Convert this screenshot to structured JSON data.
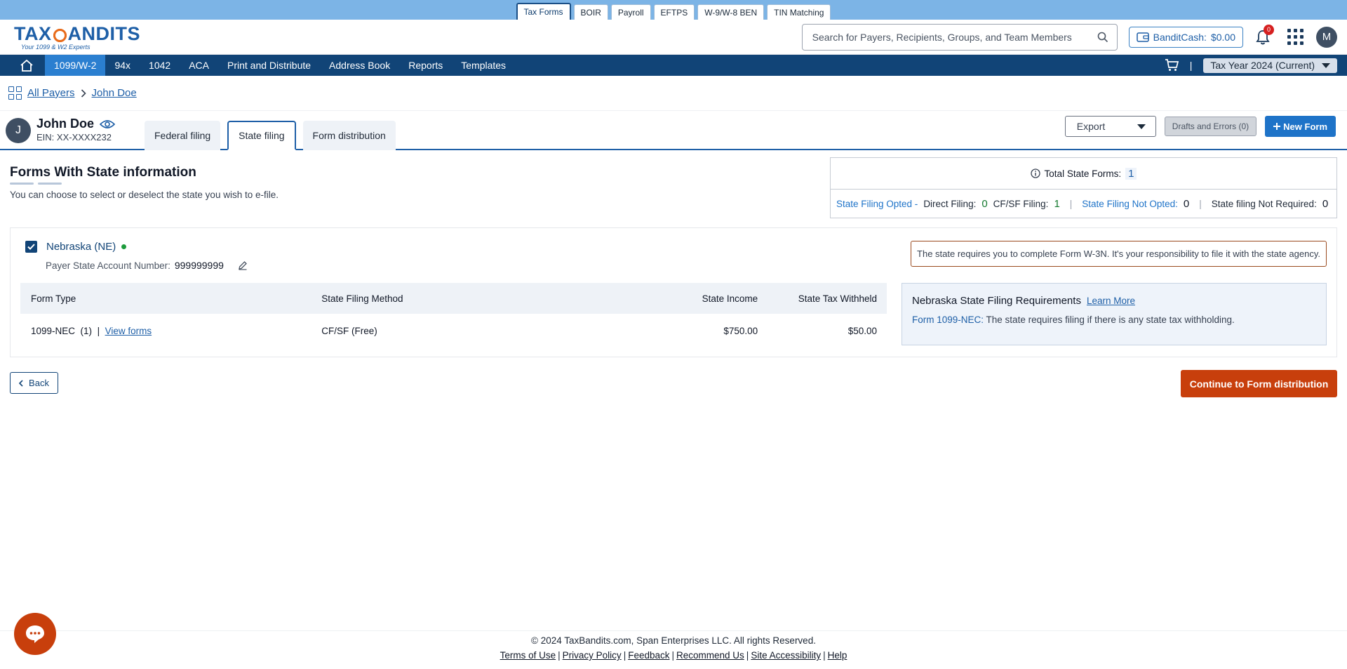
{
  "product_tabs": [
    {
      "label": "Tax Forms",
      "active": true
    },
    {
      "label": "BOIR",
      "active": false
    },
    {
      "label": "Payroll",
      "active": false
    },
    {
      "label": "EFTPS",
      "active": false
    },
    {
      "label": "W-9/W-8 BEN",
      "active": false
    },
    {
      "label": "TIN Matching",
      "active": false
    }
  ],
  "logo": {
    "brand_left": "TAX",
    "brand_right": "ANDITS",
    "tagline": "Your 1099 & W2 Experts"
  },
  "header": {
    "search_placeholder": "Search for Payers, Recipients, Groups, and Team Members",
    "bandit_cash_label": "BanditCash:",
    "bandit_cash_value": "$0.00",
    "notification_count": "0",
    "user_initial": "M"
  },
  "nav": {
    "items": [
      "1099/W-2",
      "94x",
      "1042",
      "ACA",
      "Print and Distribute",
      "Address Book",
      "Reports",
      "Templates"
    ],
    "active_index": 0,
    "divider": "|",
    "tax_year": "Tax Year 2024 (Current)"
  },
  "breadcrumb": {
    "root": "All Payers",
    "current": "John Doe"
  },
  "payer": {
    "initial": "J",
    "name": "John Doe",
    "ein": "EIN: XX-XXXX232"
  },
  "payer_tabs": [
    {
      "label": "Federal filing",
      "active": false
    },
    {
      "label": "State filing",
      "active": true
    },
    {
      "label": "Form distribution",
      "active": false
    }
  ],
  "actions": {
    "export_label": "Export",
    "drafts_label": "Drafts and Errors (0)",
    "new_form_label": "New Form"
  },
  "section": {
    "title": "Forms With State information",
    "subtitle": "You can choose to select or deselect the state you wish to e-file."
  },
  "summary": {
    "total_label": "Total State Forms:",
    "total_value": "1",
    "opted_label": "State Filing Opted -",
    "direct_label": "Direct Filing:",
    "direct_value": "0",
    "cfsf_label": "CF/SF Filing:",
    "cfsf_value": "1",
    "not_opted_label": "State Filing Not Opted:",
    "not_opted_value": "0",
    "not_required_label": "State filing Not Required:",
    "not_required_value": "0",
    "sep": "|"
  },
  "state": {
    "name": "Nebraska (NE)",
    "selected": true,
    "account_label": "Payer State Account Number:",
    "account_number": "999999999",
    "notice": "The state requires you to complete Form W-3N. It's your responsibility to file it with the state agency.",
    "table": {
      "headers": [
        "Form Type",
        "State Filing Method",
        "State Income",
        "State Tax Withheld"
      ],
      "rows": [
        {
          "form_type": "1099-NEC",
          "count": "(1)",
          "sep": "|",
          "view_link": "View forms",
          "method": "CF/SF (Free)",
          "income": "$750.00",
          "withheld": "$50.00"
        }
      ]
    },
    "requirements": {
      "title": "Nebraska State Filing Requirements",
      "learn_more": "Learn More",
      "form_label": "Form 1099-NEC:",
      "form_text": "The state requires filing if there is any state tax withholding."
    }
  },
  "buttons": {
    "back": "Back",
    "continue": "Continue to Form distribution"
  },
  "footer": {
    "copyright": "© 2024 TaxBandits.com, Span Enterprises LLC. All rights Reserved.",
    "links": [
      "Terms of Use",
      "Privacy Policy",
      "Feedback",
      "Recommend Us",
      "Site Accessibility",
      "Help"
    ],
    "sep": "|"
  },
  "colors": {
    "nav_bg": "#114477",
    "nav_active": "#2b7fd0",
    "accent": "#1e73c8",
    "continue_btn": "#c83f0c",
    "topbar": "#7cb4e6",
    "success_green": "#1d9b3c"
  }
}
